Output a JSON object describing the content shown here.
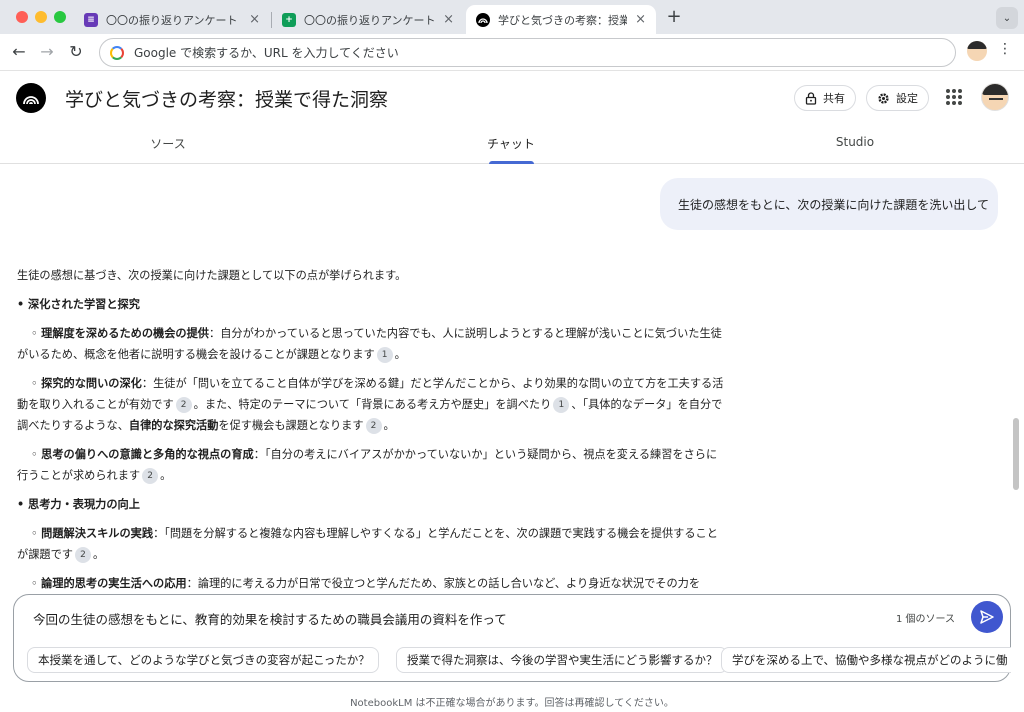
{
  "browser": {
    "tabs": [
      {
        "title": "〇〇の振り返りアンケート - Goo",
        "icon": "google-forms-icon",
        "icon_color": "#673ab7"
      },
      {
        "title": "〇〇の振り返りアンケート（回答",
        "icon": "google-sheets-icon",
        "icon_color": "#0f9d58"
      },
      {
        "title": "学びと気づきの考察：授業で得た",
        "icon": "notebooklm-icon",
        "icon_color": "#000000"
      }
    ],
    "new_tab": "+",
    "tab_close": "×",
    "tab_menu": "⌄",
    "back": "←",
    "forward": "→",
    "reload": "↻",
    "omnibox_placeholder": "Google で検索するか、URL を入力してください",
    "menu": "⋮"
  },
  "header": {
    "title": "学びと気づきの考察：授業で得た洞察",
    "share_label": "共有",
    "settings_label": "設定"
  },
  "main_tabs": [
    {
      "label": "ソース"
    },
    {
      "label": "チャット",
      "active": true
    },
    {
      "label": "Studio"
    }
  ],
  "chat": {
    "user_message": "生徒の感想をもとに、次の授業に向けた課題を洗い出して",
    "answer": {
      "intro": "生徒の感想に基づき、次の授業に向けた課題として以下の点が挙げられます。",
      "section1": "• 深化された学習と探究",
      "s1_item1": {
        "marker": "◦",
        "bold": "理解度を深めるための機会の提供",
        "text": "：自分がわかっていると思っていた内容でも、人に説明しようとすると理解が浅いことに気づいた生徒がいるため、概念を他者に説明する機会を設けることが課題となります",
        "cite": "1",
        "end": "。"
      },
      "s1_item2": {
        "marker": "◦",
        "bold": "探究的な問いの深化",
        "text1": "：生徒が「問いを立てること自体が学びを深める鍵」だと学んだことから、より効果的な問いの立て方を工夫する活動を取り入れることが有効です",
        "cite1": "2",
        "text2": "。また、特定のテーマについて「背景にある考え方や歴史」を調べたり",
        "cite2": "1",
        "text3": "、「具体的なデータ」を自分で調べたりするような、",
        "bold2": "自律的な探究活動",
        "text4": "を促す機会も課題となります",
        "cite3": "2",
        "end": "。"
      },
      "s1_item3": {
        "marker": "◦",
        "bold": "思考の偏りへの意識と多角的な視点の育成",
        "text": "：「自分の考えにバイアスがかかっていないか」という疑問から、視点を変える練習をさらに行うことが求められます",
        "cite": "2",
        "end": "。"
      },
      "section2": "• 思考力・表現力の向上",
      "s2_item1": {
        "marker": "◦",
        "bold": "問題解決スキルの実践",
        "text": "：「問題を分解すると複雑な内容も理解しやすくなる」と学んだことを、次の課題で実践する機会を提供することが課題です",
        "cite": "2",
        "end": "。"
      },
      "s2_item2": {
        "marker": "◦",
        "bold": "論理的思考の実生活への応用",
        "text": "：論理的に考える力が日常で役立つと学んだため、家族との話し合いなど、より身近な状況でその力を"
      }
    }
  },
  "composer": {
    "input_value": "今回の生徒の感想をもとに、教育的効果を検討するための職員会議用の資料を作って",
    "source_count": "1 個のソース",
    "suggestions": [
      "本授業を通して、どのような学びと気づきの変容が起こったか？",
      "授業で得た洞察は、今後の学習や実生活にどう影響するか？",
      "学びを深める上で、協働や多様な視点がどのように働"
    ]
  },
  "footer": "NotebookLM は不正確な場合があります。回答は再確認してください。",
  "colors": {
    "accent": "#4569d3",
    "send_button": "#4057cf",
    "user_bubble": "#edf0f9"
  }
}
